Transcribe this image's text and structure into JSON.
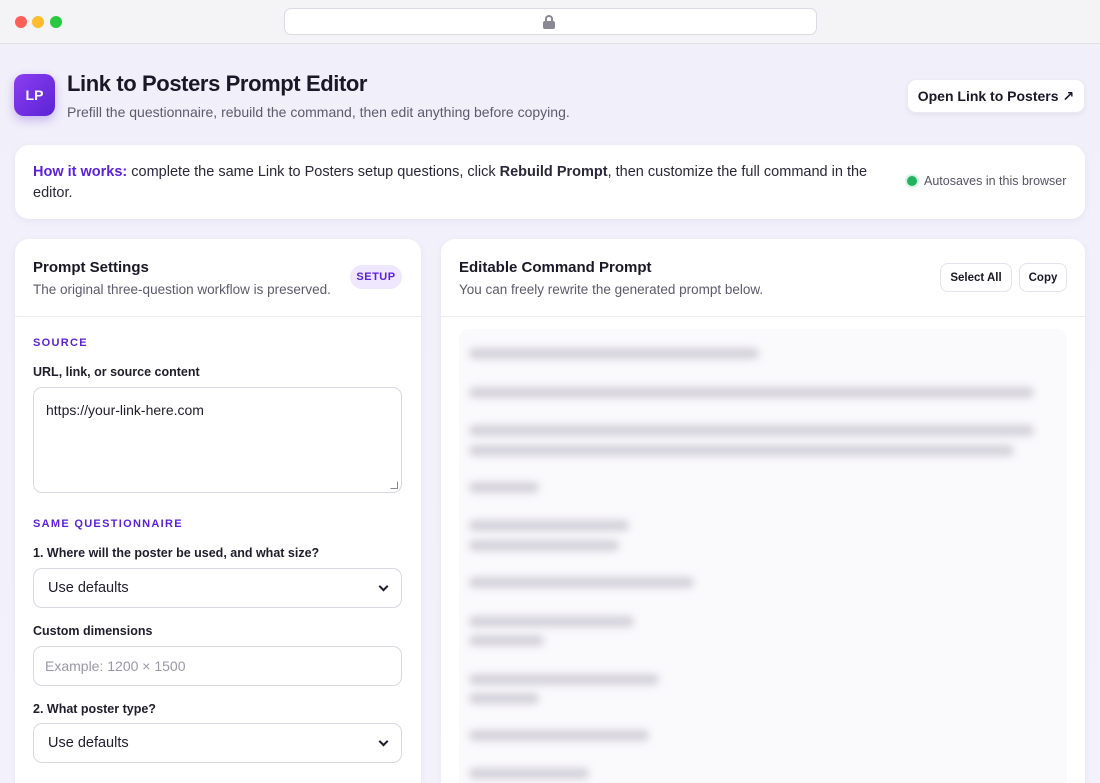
{
  "browser": {
    "lock_icon": "lock-icon"
  },
  "header": {
    "logo_text": "LP",
    "title": "Link to Posters Prompt Editor",
    "subtitle": "Prefill the questionnaire, rebuild the command, then edit anything before copying.",
    "open_button": "Open Link to Posters",
    "open_button_icon": "↗"
  },
  "how_it_works": {
    "lead": "How it works:",
    "text_before": " complete the same Link to Posters setup questions, click ",
    "bold": "Rebuild Prompt",
    "text_after": ", then customize the full command in the editor.",
    "autosave": "Autosaves in this browser",
    "autosave_color": "#22b35e"
  },
  "settings": {
    "title": "Prompt Settings",
    "subtitle": "The original three-question workflow is preserved.",
    "badge": "SETUP",
    "source_label": "SOURCE",
    "url_label": "URL, link, or source content",
    "url_value": "https://your-link-here.com",
    "questionnaire_label": "SAME QUESTIONNAIRE",
    "q1_label": "1. Where will the poster be used, and what size?",
    "q1_value": "Use defaults",
    "custom_dim_label": "Custom dimensions",
    "custom_dim_placeholder": "Example: 1200 × 1500",
    "q2_label": "2. What poster type?",
    "q2_value": "Use defaults"
  },
  "editor": {
    "title": "Editable Command Prompt",
    "subtitle": "You can freely rewrite the generated prompt below.",
    "select_all": "Select All",
    "copy": "Copy"
  },
  "colors": {
    "accent": "#5b22d6",
    "background": "#f1effa"
  }
}
